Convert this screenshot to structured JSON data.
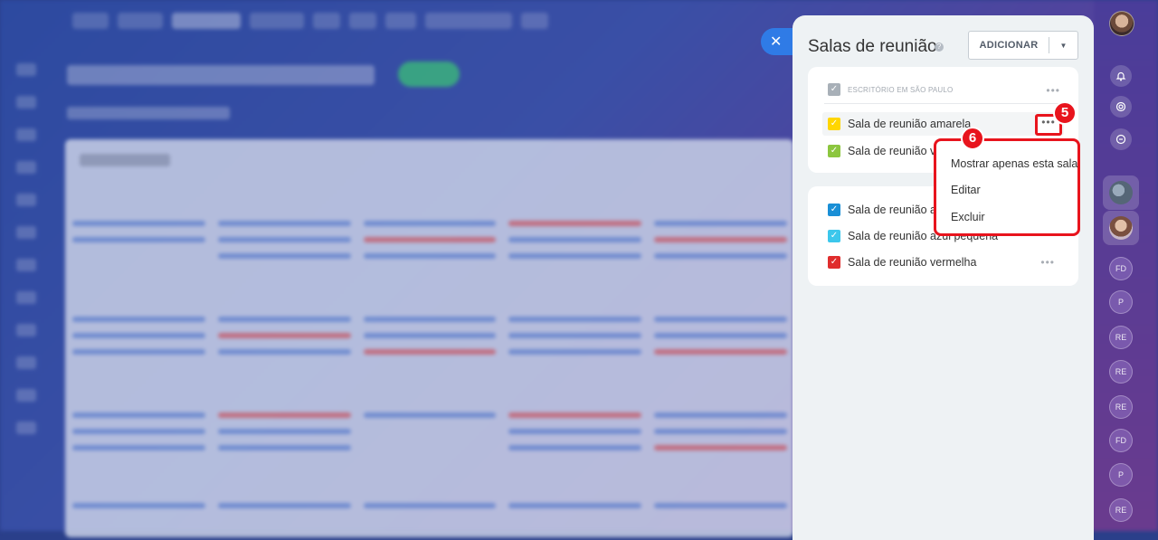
{
  "panel": {
    "title": "Salas de reunião",
    "add_label": "ADICIONAR"
  },
  "group": {
    "label": "ESCRITÓRIO EM SÃO PAULO"
  },
  "rooms_group1": [
    {
      "name": "Sala de reunião amarela",
      "color": "#ffd600"
    },
    {
      "name": "Sala de reunião verde",
      "color": "#8cc63f"
    }
  ],
  "rooms_group2": [
    {
      "name": "Sala de reunião azul",
      "color": "#1a8fd6"
    },
    {
      "name": "Sala de reunião azul pequena",
      "color": "#3cc7ec"
    },
    {
      "name": "Sala de reunião vermelha",
      "color": "#e02d2d"
    }
  ],
  "context_menu": {
    "items": [
      "Mostrar apenas esta sala",
      "Editar",
      "Excluir"
    ]
  },
  "steps": {
    "dots_badge": "5",
    "menu_badge": "6"
  },
  "right_bar": {
    "initials": [
      "FD",
      "P",
      "RE",
      "RE",
      "RE",
      "FD",
      "P",
      "RE"
    ]
  },
  "icons": {
    "close": "close-icon",
    "check": "check-icon",
    "help": "help-icon",
    "more": "more-dots-icon"
  },
  "colors": {
    "accent": "#2f7be6",
    "highlight": "#e8141d",
    "group_check": "#a8b0b8"
  }
}
